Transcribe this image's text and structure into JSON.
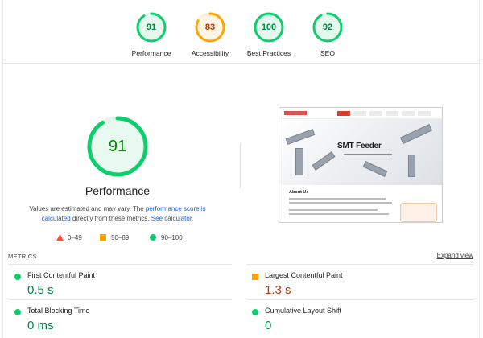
{
  "colors": {
    "pass": "#0cce6b",
    "pass_text": "#008800",
    "average": "#ffa400",
    "average_text": "#c33300",
    "fail": "#ff4e42"
  },
  "categories": [
    {
      "label": "Performance",
      "score": "91",
      "value": 91,
      "rating": "pass"
    },
    {
      "label": "Accessibility",
      "score": "83",
      "value": 83,
      "rating": "average"
    },
    {
      "label": "Best Practices",
      "score": "100",
      "value": 100,
      "rating": "pass"
    },
    {
      "label": "SEO",
      "score": "92",
      "value": 92,
      "rating": "pass"
    }
  ],
  "performance": {
    "score": "91",
    "value": 91,
    "title": "Performance",
    "desc_prefix": "Values are estimated and may vary. The ",
    "desc_link1": "performance score is calculated",
    "desc_middle": " directly from these metrics. ",
    "desc_link2": "See calculator."
  },
  "legend": [
    {
      "range": "0–49",
      "shape": "triangle-icon",
      "rating": "fail"
    },
    {
      "range": "50–89",
      "shape": "square-icon",
      "rating": "average"
    },
    {
      "range": "90–100",
      "shape": "circle-icon",
      "rating": "pass"
    }
  ],
  "screenshot": {
    "hero_title": "SMT Feeder",
    "section_title": "About Us"
  },
  "metrics": {
    "heading": "METRICS",
    "expand_label": "Expand view",
    "items": [
      {
        "name": "First Contentful Paint",
        "value": "0.5 s",
        "rating": "pass"
      },
      {
        "name": "Largest Contentful Paint",
        "value": "1.3 s",
        "rating": "average"
      },
      {
        "name": "Total Blocking Time",
        "value": "0 ms",
        "rating": "pass"
      },
      {
        "name": "Cumulative Layout Shift",
        "value": "0",
        "rating": "pass"
      }
    ]
  }
}
